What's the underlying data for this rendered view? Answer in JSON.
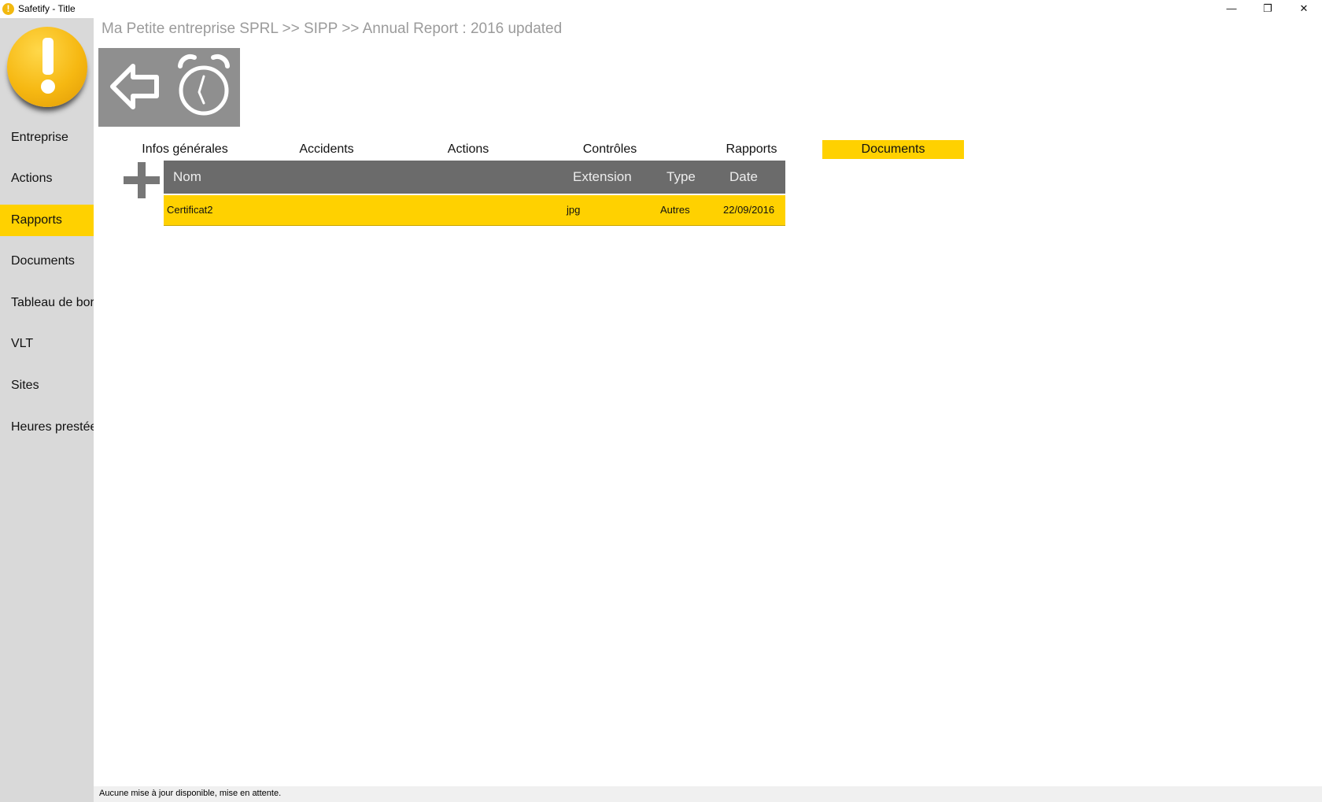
{
  "window": {
    "title": "Safetify - Title",
    "minimize": "—",
    "restore": "❐",
    "close": "✕"
  },
  "sidebar": {
    "items": [
      {
        "label": "Entreprise"
      },
      {
        "label": "Actions"
      },
      {
        "label": "Rapports"
      },
      {
        "label": "Documents"
      },
      {
        "label": "Tableau de bord"
      },
      {
        "label": "VLT"
      },
      {
        "label": "Sites"
      },
      {
        "label": "Heures prestées"
      }
    ],
    "active": "Rapports"
  },
  "breadcrumb": "Ma Petite entreprise SPRL >> SIPP >> Annual Report : 2016 updated",
  "toolbar": {
    "back_icon": "back-arrow-icon",
    "timer_icon": "alarm-clock-icon"
  },
  "tabs": [
    {
      "label": "Infos générales"
    },
    {
      "label": "Accidents"
    },
    {
      "label": "Actions"
    },
    {
      "label": "Contrôles"
    },
    {
      "label": "Rapports"
    },
    {
      "label": "Documents"
    }
  ],
  "active_tab": "Documents",
  "grid": {
    "columns": [
      "Nom",
      "Extension",
      "Type",
      "Date"
    ],
    "rows": [
      {
        "name": "Certificat2",
        "extension": "jpg",
        "type": "Autres",
        "date": "22/09/2016"
      }
    ]
  },
  "status": "Aucune mise à jour disponible, mise en attente.",
  "colors": {
    "accent": "#ffd100",
    "header": "#6b6b6b",
    "sidebar": "#d9d9d9",
    "toolbar": "#8f8f8f"
  }
}
